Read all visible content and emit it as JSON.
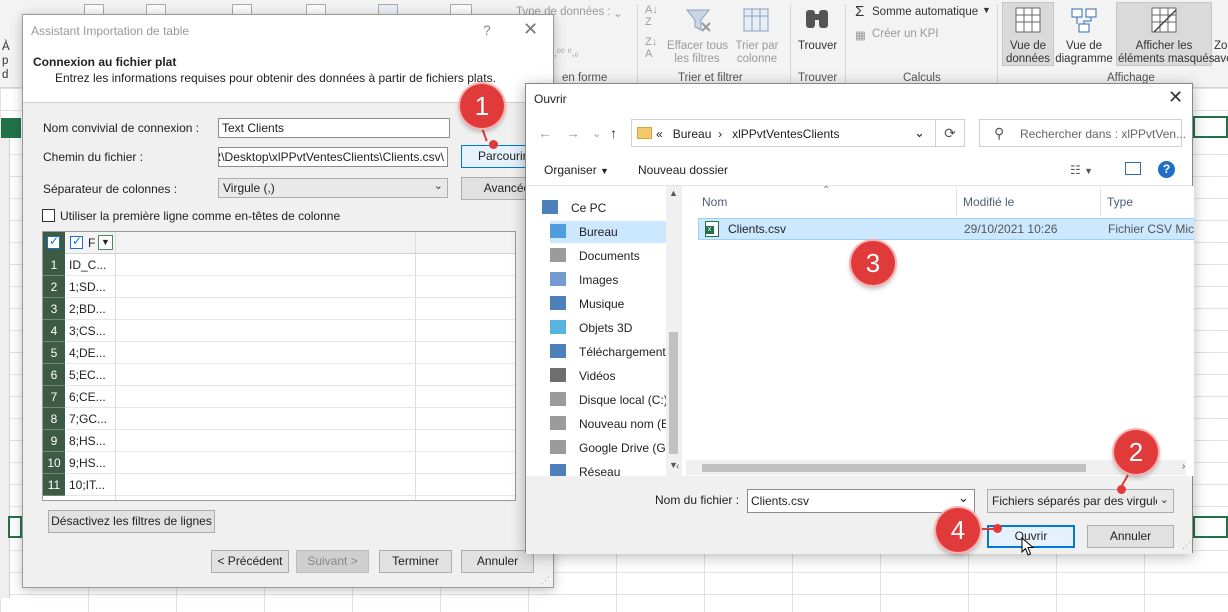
{
  "ribbon": {
    "left_partial": "À p d",
    "type_donnees": "Type de données :",
    "en_forme": "en forme",
    "effacer_filtres": [
      "Effacer tous",
      "les filtres"
    ],
    "trier_par_colonne": [
      "Trier par",
      "colonne"
    ],
    "trier_filtrer_group": "Trier et filtrer",
    "trouver": "Trouver",
    "trouver_group": "Trouver",
    "somme_auto": "Somme automatique",
    "creer_kpi": "Créer un KPI",
    "calculs_group": "Calculs",
    "vue_donnees": [
      "Vue de",
      "données"
    ],
    "vue_diagramme": [
      "Vue de",
      "diagramme"
    ],
    "afficher_masques": [
      "Afficher les",
      "éléments masqués"
    ],
    "zoom_partial": [
      "Zo",
      "ave"
    ],
    "affichage_group": "Affichage"
  },
  "import_wizard": {
    "title": "Assistant Importation de table",
    "help": "?",
    "close": "✕",
    "header_title": "Connexion au fichier plat",
    "header_subtitle": "Entrez les informations requises pour obtenir des données à partir de fichiers plats.",
    "friendly_name_label": "Nom convivial de connexion :",
    "friendly_name_value": "Text Clients",
    "file_path_label": "Chemin du fichier :",
    "file_path_value": "\\CER\\Desktop\\xlPPvtVentesClients\\Clients.csv",
    "browse_button": "Parcourir...",
    "separator_label": "Séparateur de colonnes :",
    "separator_value": "Virgule (,)",
    "advanced_button": "Avancée",
    "first_row_header_label": "Utiliser la première ligne comme en-têtes de colonne",
    "preview_header_col": "F",
    "preview_rows": [
      {
        "n": "1",
        "v": "ID_C..."
      },
      {
        "n": "2",
        "v": "1;SD..."
      },
      {
        "n": "3",
        "v": "2;BD..."
      },
      {
        "n": "4",
        "v": "3;CS..."
      },
      {
        "n": "5",
        "v": "4;DE..."
      },
      {
        "n": "6",
        "v": "5;EC..."
      },
      {
        "n": "7",
        "v": "6;CE..."
      },
      {
        "n": "8",
        "v": "7;GC..."
      },
      {
        "n": "9",
        "v": "8;HS..."
      },
      {
        "n": "10",
        "v": "9;HS..."
      },
      {
        "n": "11",
        "v": "10;IT..."
      }
    ],
    "disable_filters_button": "Désactivez les filtres de lignes",
    "previous_button": "< Précédent",
    "next_button": "Suivant >",
    "finish_button": "Terminer",
    "cancel_button": "Annuler"
  },
  "open_dialog": {
    "title": "Ouvrir",
    "close": "✕",
    "breadcrumb_prefix": "«",
    "breadcrumb": [
      "Bureau",
      "xlPPvtVentesClients"
    ],
    "search_placeholder": "Rechercher dans : xlPPvtVen...",
    "organize": "Organiser",
    "new_folder": "Nouveau dossier",
    "nav_items": [
      {
        "label": "Ce PC",
        "icon": "computer-icon"
      },
      {
        "label": "Bureau",
        "icon": "desktop-icon"
      },
      {
        "label": "Documents",
        "icon": "documents-icon"
      },
      {
        "label": "Images",
        "icon": "images-icon"
      },
      {
        "label": "Musique",
        "icon": "music-icon"
      },
      {
        "label": "Objets 3D",
        "icon": "objects-3d-icon"
      },
      {
        "label": "Téléchargements",
        "icon": "downloads-icon"
      },
      {
        "label": "Vidéos",
        "icon": "videos-icon"
      },
      {
        "label": "Disque local (C:)",
        "icon": "drive-icon"
      },
      {
        "label": "Nouveau nom (E",
        "icon": "drive-icon"
      },
      {
        "label": "Google Drive (G:",
        "icon": "drive-icon"
      },
      {
        "label": "Réseau",
        "icon": "network-icon"
      }
    ],
    "columns": {
      "name": "Nom",
      "modified": "Modifié le",
      "type": "Type"
    },
    "files": [
      {
        "name": "Clients.csv",
        "modified": "29/10/2021 10:26",
        "type": "Fichier CSV Micr"
      }
    ],
    "filename_label": "Nom du fichier :",
    "filename_value": "Clients.csv",
    "filetype_value": "Fichiers séparés par des virgules",
    "open_button": "Ouvrir",
    "cancel_button": "Annuler"
  },
  "callouts": [
    "1",
    "2",
    "3",
    "4"
  ],
  "colors": {
    "accent": "#0078d7",
    "callout": "#e03a3a",
    "excel_green": "#217346",
    "selection": "#cce8ff"
  }
}
